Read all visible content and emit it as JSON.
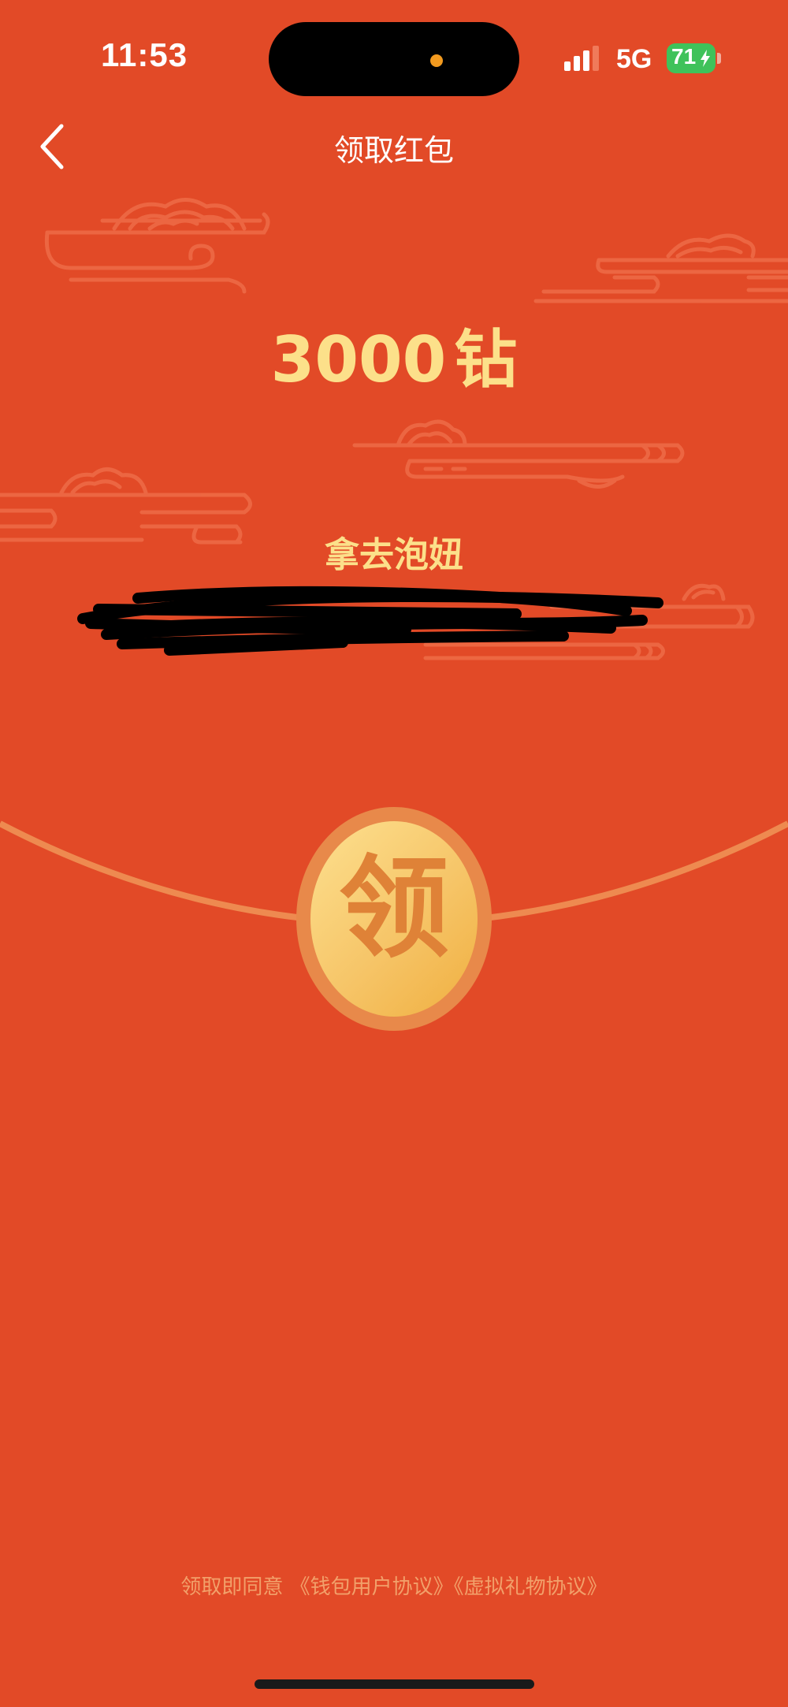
{
  "status_bar": {
    "time": "11:53",
    "network": "5G",
    "battery": "71"
  },
  "header": {
    "title": "领取红包",
    "back_icon": "chevron-left-icon"
  },
  "red_packet": {
    "amount": "3000",
    "unit": "钻",
    "message": "拿去泡妞",
    "claim_label": "领"
  },
  "footer": {
    "agreement_prefix": "领取即同意",
    "wallet_agreement": "《钱包用户协议》",
    "gift_agreement": "《虚拟礼物协议》"
  },
  "colors": {
    "background": "#E24A27",
    "gold_text": "#FCE08A",
    "claim_button": "#F6C568",
    "battery": "#3FC25A"
  }
}
